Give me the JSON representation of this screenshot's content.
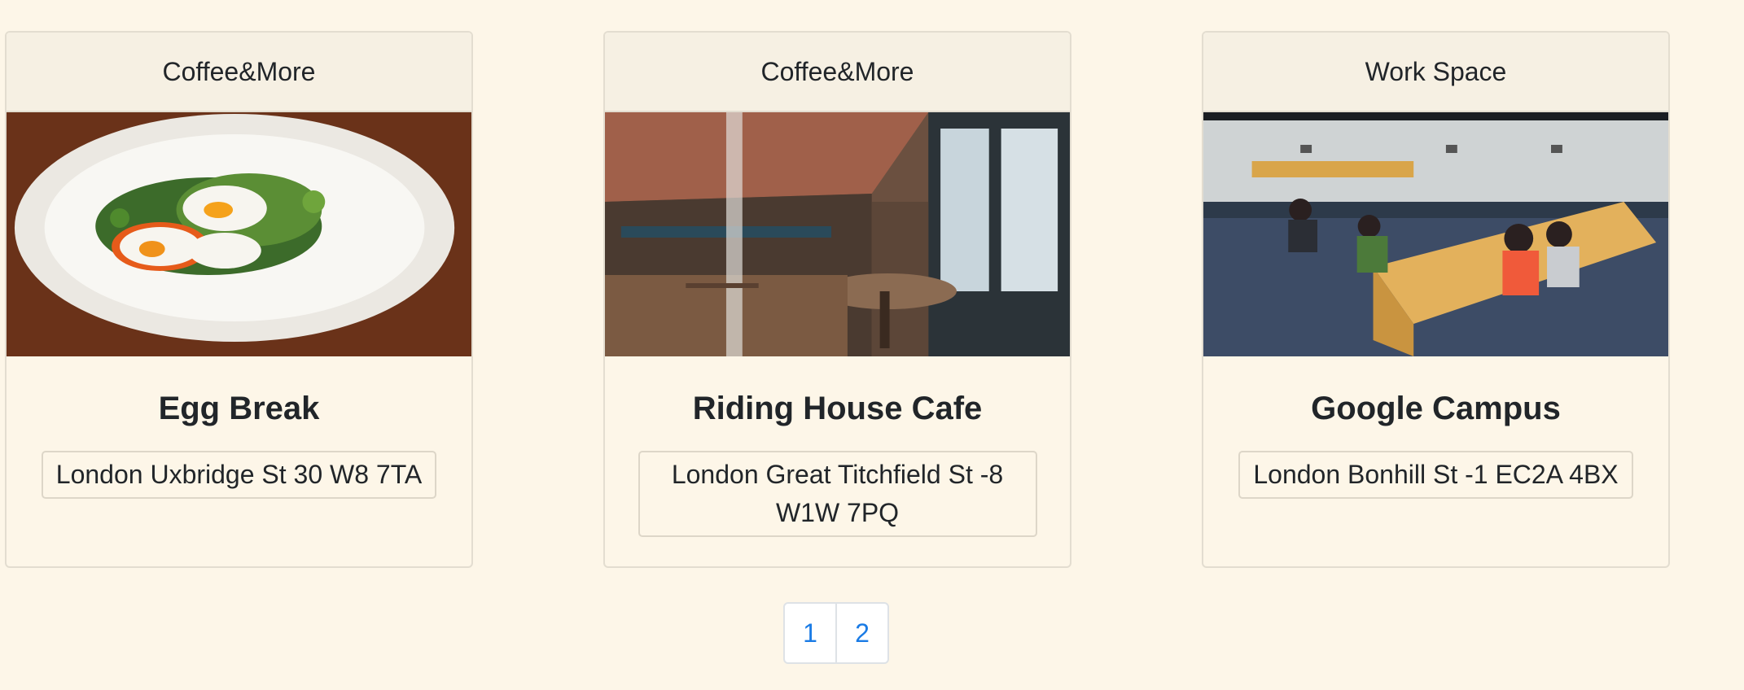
{
  "cards": [
    {
      "category": "Coffee&More",
      "title": "Egg Break",
      "address": "London Uxbridge St 30 W8 7TA"
    },
    {
      "category": "Coffee&More",
      "title": "Riding House Cafe",
      "address": "London Great Titchfield St -8 W1W 7PQ"
    },
    {
      "category": "Work Space",
      "title": "Google Campus",
      "address": "London Bonhill St -1 EC2A 4BX"
    }
  ],
  "pagination": {
    "pages": [
      "1",
      "2"
    ]
  },
  "colors": {
    "background": "#fdf6e8",
    "card_header": "#f6f0e3",
    "link": "#1a7be5"
  }
}
